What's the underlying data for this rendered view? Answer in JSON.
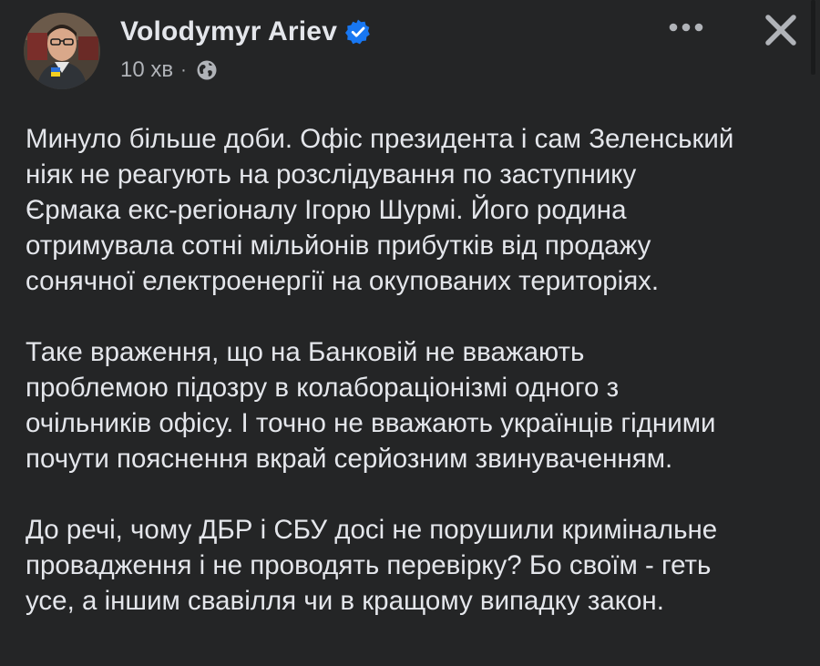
{
  "author": {
    "name": "Volodymyr Ariev",
    "verified_icon": "verified-badge-icon",
    "avatar_icon": "avatar"
  },
  "meta": {
    "time": "10 хв",
    "separator": "·",
    "audience_icon": "globe-icon"
  },
  "actions": {
    "more_icon": "more-options-icon",
    "close_icon": "close-icon"
  },
  "post": {
    "paragraphs": [
      {
        "lines": [
          "Минуло більше доби. Офіс президента і сам Зеленський",
          "ніяк не реагують на розслідування по заступнику",
          "Єрмака екс-регіоналу Ігорю Шурмі. Його родина",
          "отримувала сотні мільйонів прибутків від продажу",
          "сонячної електроенергії на окупованих територіях."
        ]
      },
      {
        "lines": [
          "Таке враження, що на Банковій не вважають",
          "проблемою підозру в колабораціонізмі одного з",
          "очільників офісу. І точно не вважають українців гідними",
          "почути пояснення вкрай серйозним звинуваченням."
        ]
      },
      {
        "lines": [
          "До речі, чому ДБР і СБУ досі не порушили кримінальне",
          "провадження і не проводять перевірку? Бо своїм - геть",
          "усе, а іншим свавілля чи в кращому випадку закон."
        ]
      }
    ]
  },
  "colors": {
    "background": "#242526",
    "primary_text": "#e4e6eb",
    "secondary_text": "#b0b3b8",
    "verified_blue": "#1877f2"
  }
}
